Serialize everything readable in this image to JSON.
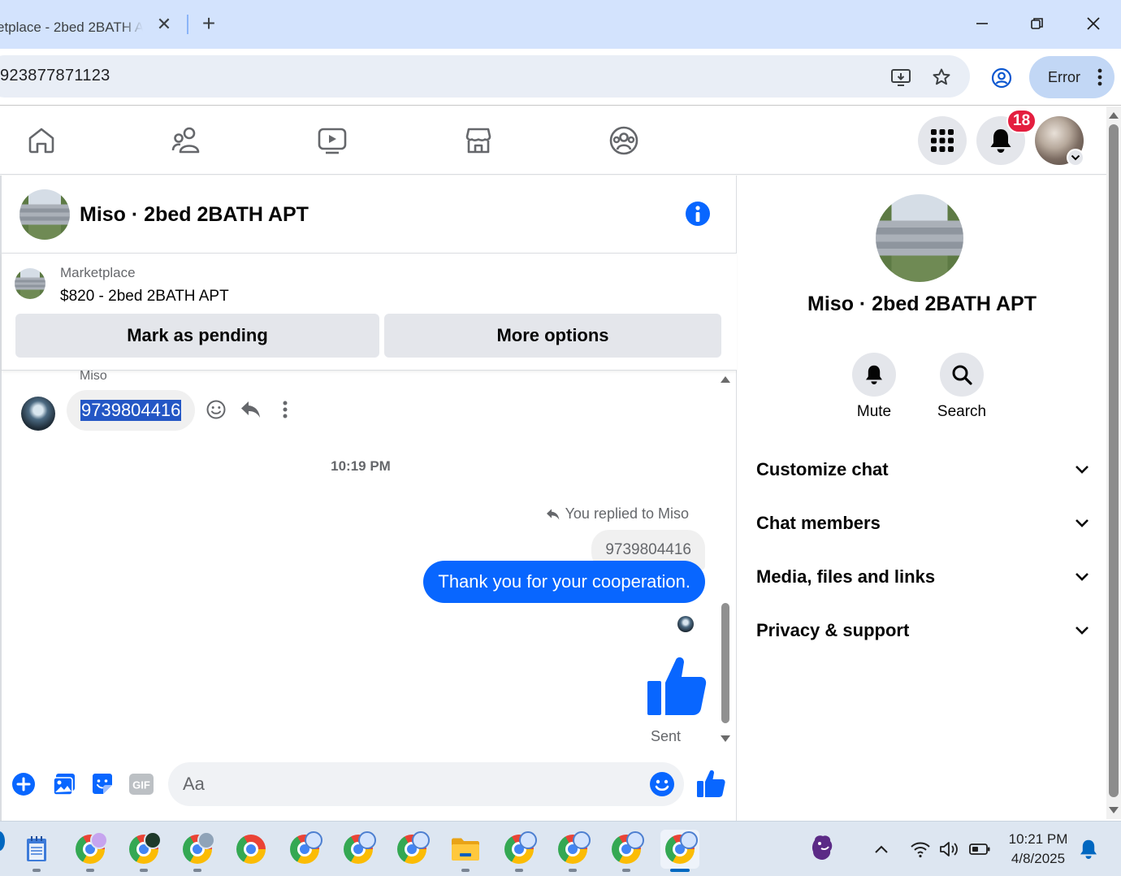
{
  "browser": {
    "tab_title": "etplace - 2bed 2BATH APT",
    "url": "923877871123",
    "error_label": "Error"
  },
  "fb_nav": {
    "notification_count": "18"
  },
  "chat": {
    "title": "Miso · 2bed 2BATH APT",
    "marketplace_label": "Marketplace",
    "listing": "$820 - 2bed 2BATH APT",
    "mark_pending_label": "Mark as pending",
    "more_options_label": "More options",
    "sender_name": "Miso",
    "incoming_message": "9739804416",
    "time_separator": "10:19 PM",
    "reply_note": "You replied to Miso",
    "quoted_text": "9739804416",
    "outgoing_message": "Thank you for your cooperation.",
    "sent_label": "Sent",
    "composer_placeholder": "Aa"
  },
  "info_panel": {
    "name": "Miso · 2bed 2BATH APT",
    "mute_label": "Mute",
    "search_label": "Search",
    "sections": [
      "Customize chat",
      "Chat members",
      "Media, files and links",
      "Privacy & support"
    ]
  },
  "taskbar": {
    "time": "10:21 PM",
    "date": "4/8/2025"
  },
  "colors": {
    "fb_blue": "#0866ff",
    "badge_red": "#e41e3f",
    "selection": "#2457c5",
    "chrome_tab": "#d3e3fd"
  },
  "icons": [
    "home-icon",
    "friends-icon",
    "video-icon",
    "marketplace-icon",
    "groups-icon",
    "menu-grid-icon",
    "bell-icon",
    "info-icon",
    "emoji-icon",
    "reply-icon",
    "more-icon",
    "like-icon",
    "plus-icon",
    "gallery-icon",
    "sticker-icon",
    "gif-icon",
    "search-icon",
    "chevron-down-icon"
  ]
}
